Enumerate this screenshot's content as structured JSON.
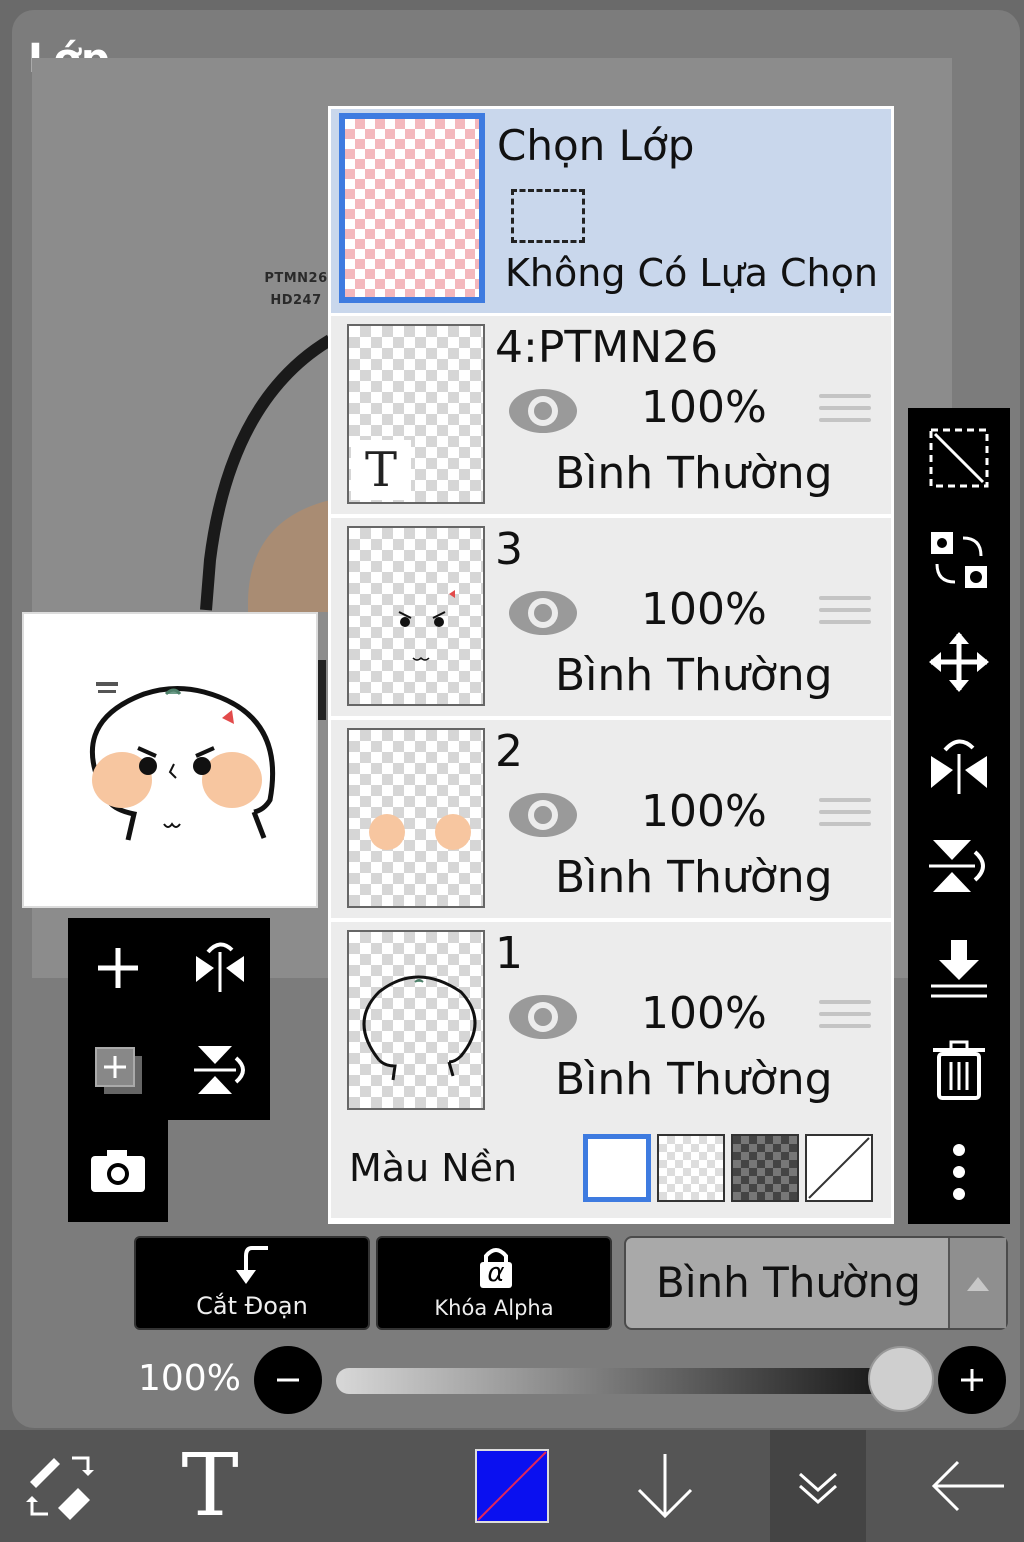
{
  "panel": {
    "title": "Lớp"
  },
  "canvas": {
    "watermark_line1": "PTMN26",
    "watermark_line2": "HD247"
  },
  "selection_layer": {
    "title": "Chọn Lớp",
    "status": "Không Có Lựa Chọn"
  },
  "layers": [
    {
      "name": "4:PTMN26",
      "opacity": "100%",
      "blend": "Bình Thường",
      "type": "text",
      "type_glyph": "T"
    },
    {
      "name": "3",
      "opacity": "100%",
      "blend": "Bình Thường"
    },
    {
      "name": "2",
      "opacity": "100%",
      "blend": "Bình Thường"
    },
    {
      "name": "1",
      "opacity": "100%",
      "blend": "Bình Thường"
    }
  ],
  "background": {
    "label": "Màu Nền",
    "options": [
      "white",
      "checker-light",
      "checker-dark",
      "none"
    ],
    "selected": "white"
  },
  "left_tools": [
    "add-layer-icon",
    "flip-horizontal-icon",
    "add-layer-copy-icon",
    "flip-vertical-icon",
    "camera-icon"
  ],
  "right_tools": [
    "selection-transform-icon",
    "swap-layers-icon",
    "move-icon",
    "flip-horizontal-icon",
    "flip-vertical-icon",
    "merge-down-icon",
    "trash-icon",
    "more-icon"
  ],
  "clipping": {
    "label": "Cắt Đoạn"
  },
  "alpha_lock": {
    "label": "Khóa Alpha",
    "symbol": "α"
  },
  "blend_mode": {
    "value": "Bình Thường"
  },
  "opacity": {
    "label": "100%",
    "value": 1.0
  },
  "bottom_bar": {
    "tools": [
      "brush-eraser-swap-icon",
      "text-tool-icon",
      "color-swatch",
      "down-arrow-icon",
      "collapse-icon",
      "back-arrow-icon"
    ],
    "text_glyph": "T",
    "color": "#0a10f0"
  },
  "colors": {
    "accent": "#3e7be0",
    "selected_row": "#c9d7ec",
    "row": "#ececec"
  }
}
